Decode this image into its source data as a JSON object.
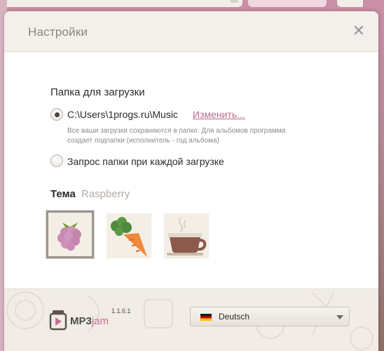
{
  "dialog": {
    "title": "Настройки",
    "close_symbol": "✕"
  },
  "download_folder": {
    "section_title": "Папка для загрузки",
    "options": [
      {
        "label": "C:\\Users\\1progs.ru\\Music",
        "checked": true
      },
      {
        "label": "Запрос папки при каждой загрузке",
        "checked": false
      }
    ],
    "change_link": "Изменить...",
    "hint": "Все ваши загрузки сохраняются в папке. Для альбомов программа создает подпапки (исполнитель - год альбома)"
  },
  "theme": {
    "label": "Тема",
    "current": "Raspberry",
    "items": [
      {
        "icon": "raspberry-icon",
        "selected": true
      },
      {
        "icon": "carrot-icon",
        "selected": false
      },
      {
        "icon": "coffee-cup-icon",
        "selected": false
      }
    ]
  },
  "footer": {
    "logo_main": "MP3",
    "logo_accent": "jam",
    "version": "1.1.6.1",
    "language": {
      "selected": "Deutsch",
      "flag_icon": "germany-flag-icon"
    }
  },
  "colors": {
    "accent": "#c46f93",
    "link": "#b96c8c"
  }
}
